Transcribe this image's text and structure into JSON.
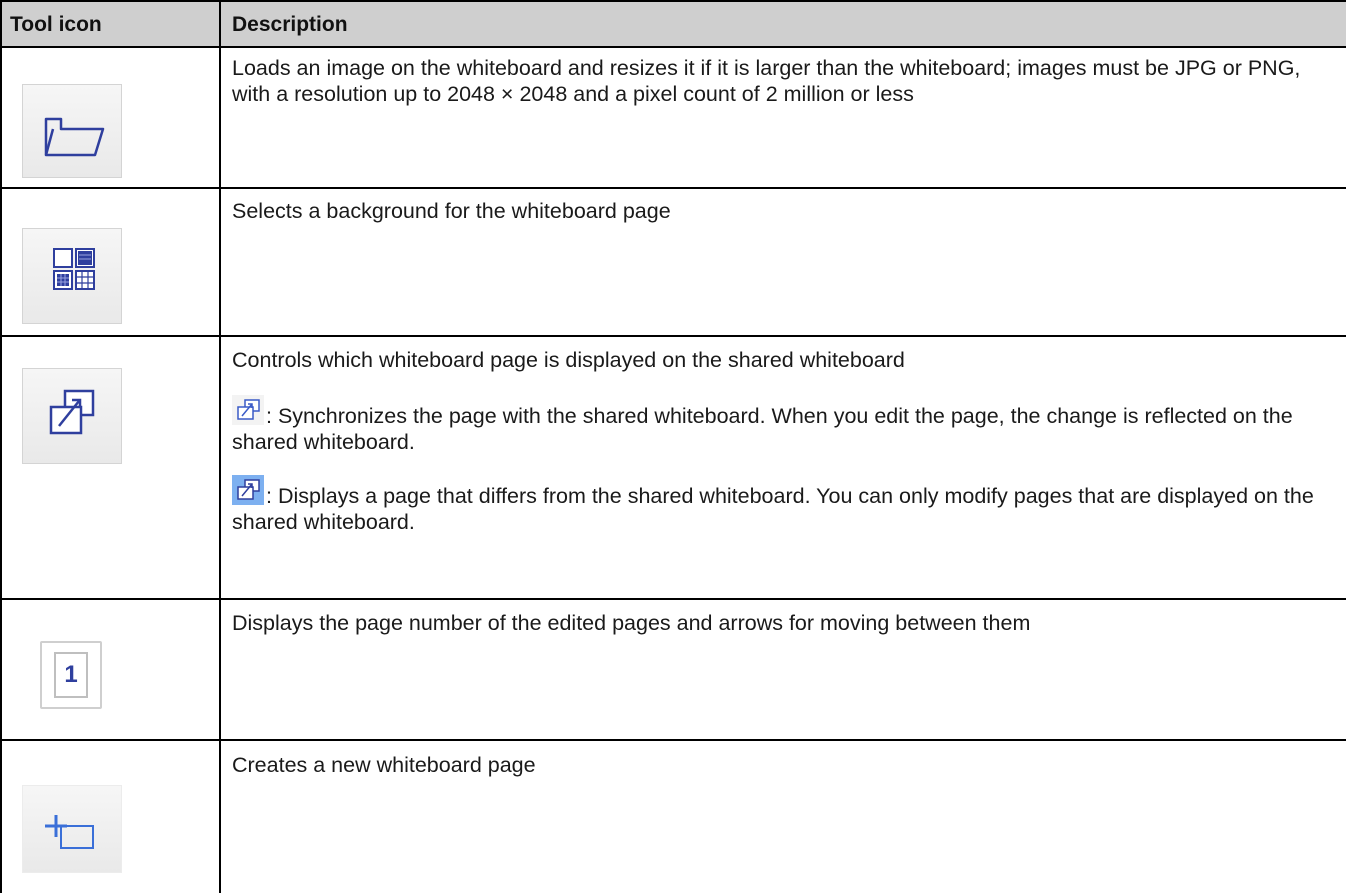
{
  "table": {
    "headers": {
      "tool_icon": "Tool icon",
      "description": "Description"
    },
    "rows": [
      {
        "icon": "folder-icon",
        "description": "Loads an image on the whiteboard and resizes it if it is larger than the whiteboard; images must be JPG or PNG, with a resolution up to 2048 × 2048 and a pixel count of 2 million or less"
      },
      {
        "icon": "background-grid-icon",
        "description": "Selects a background for the whiteboard page"
      },
      {
        "icon": "page-sync-icon",
        "description": "Controls which whiteboard page is displayed on the shared whiteboard",
        "notes": [
          {
            "icon": "sync-on-icon",
            "text": ": Synchronizes the page with the shared whiteboard. When you edit the page, the change is reflected on the shared whiteboard."
          },
          {
            "icon": "sync-off-icon",
            "text": ": Displays a page that differs from the shared whiteboard. You can only modify pages that are displayed on the shared whiteboard."
          }
        ]
      },
      {
        "icon": "page-number-icon",
        "icon_text": "1",
        "description": "Displays the page number of the edited pages and arrows for moving between them"
      },
      {
        "icon": "new-page-icon",
        "description": "Creates a new whiteboard page"
      }
    ]
  },
  "colors": {
    "header_bg": "#cfcfcf",
    "icon_blue": "#2f3f9e",
    "border": "#000000"
  }
}
